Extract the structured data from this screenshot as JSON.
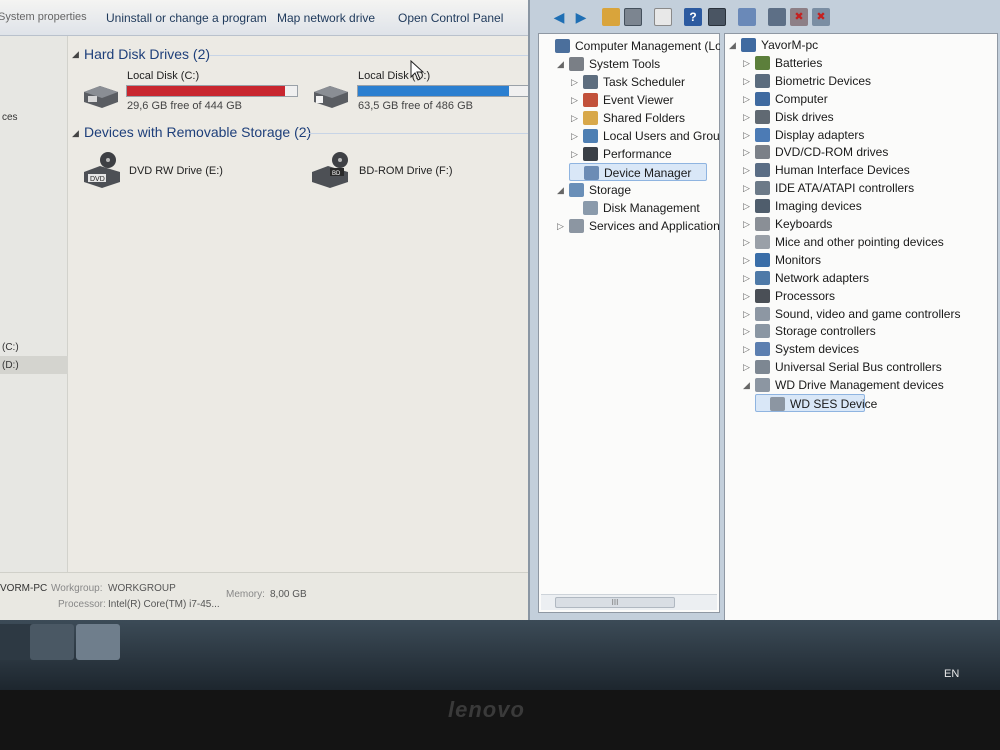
{
  "explorer": {
    "toolbar": {
      "system_properties": "System properties",
      "uninstall": "Uninstall or change a program",
      "map_drive": "Map network drive",
      "control_panel": "Open Control Panel"
    },
    "nav": {
      "item1": "ces",
      "drive_c": "(C:)",
      "drive_d": "(D:)"
    },
    "hard_disk_header": "Hard Disk Drives (2)",
    "removable_header": "Devices with Removable Storage (2)",
    "drives": [
      {
        "name": "Local Disk (C:)",
        "free": "29,6 GB free of 444 GB",
        "used_fraction": 0.93,
        "bar_color": "#c8262f"
      },
      {
        "name": "Local Disk (D:)",
        "free": "63,5 GB free of 486 GB",
        "used_fraction": 0.87,
        "bar_color": "#2b7fd0"
      }
    ],
    "removable": [
      {
        "name": "DVD RW Drive (E:)",
        "icon_text": "DVD"
      },
      {
        "name": "BD-ROM Drive (F:)",
        "icon_text": "BD"
      }
    ],
    "details": {
      "pc": "VORM-PC",
      "workgroup_label": "Workgroup:",
      "workgroup": "WORKGROUP",
      "memory_label": "Memory:",
      "memory": "8,00 GB",
      "processor_label": "Processor:",
      "processor": "Intel(R) Core(TM) i7-45..."
    }
  },
  "computer_management": {
    "tree": [
      {
        "label": "Computer Management (Local",
        "icon": "computer-management-icon",
        "expander": "",
        "indent": 0
      },
      {
        "label": "System Tools",
        "icon": "system-tools-icon",
        "expander": "◢",
        "indent": 1
      },
      {
        "label": "Task Scheduler",
        "icon": "task-scheduler-icon",
        "expander": "▷",
        "indent": 2
      },
      {
        "label": "Event Viewer",
        "icon": "event-viewer-icon",
        "expander": "▷",
        "indent": 2
      },
      {
        "label": "Shared Folders",
        "icon": "shared-folders-icon",
        "expander": "▷",
        "indent": 2
      },
      {
        "label": "Local Users and Groups",
        "icon": "local-users-icon",
        "expander": "▷",
        "indent": 2
      },
      {
        "label": "Performance",
        "icon": "performance-icon",
        "expander": "▷",
        "indent": 2
      },
      {
        "label": "Device Manager",
        "icon": "device-manager-icon",
        "expander": "",
        "indent": 2,
        "selected": true
      },
      {
        "label": "Storage",
        "icon": "storage-icon",
        "expander": "◢",
        "indent": 1
      },
      {
        "label": "Disk Management",
        "icon": "disk-management-icon",
        "expander": "",
        "indent": 2
      },
      {
        "label": "Services and Applications",
        "icon": "services-icon",
        "expander": "▷",
        "indent": 1
      }
    ],
    "tree_scroll_glyph": "III",
    "devices": [
      {
        "label": "YavorM-pc",
        "icon": "computer-icon",
        "expander": "◢",
        "indent": 0
      },
      {
        "label": "Batteries",
        "icon": "battery-icon",
        "expander": "▷",
        "indent": 1
      },
      {
        "label": "Biometric Devices",
        "icon": "biometric-icon",
        "expander": "▷",
        "indent": 1
      },
      {
        "label": "Computer",
        "icon": "computer-icon",
        "expander": "▷",
        "indent": 1
      },
      {
        "label": "Disk drives",
        "icon": "disk-drive-icon",
        "expander": "▷",
        "indent": 1
      },
      {
        "label": "Display adapters",
        "icon": "display-adapter-icon",
        "expander": "▷",
        "indent": 1
      },
      {
        "label": "DVD/CD-ROM drives",
        "icon": "dvd-icon",
        "expander": "▷",
        "indent": 1
      },
      {
        "label": "Human Interface Devices",
        "icon": "hid-icon",
        "expander": "▷",
        "indent": 1
      },
      {
        "label": "IDE ATA/ATAPI controllers",
        "icon": "ide-icon",
        "expander": "▷",
        "indent": 1
      },
      {
        "label": "Imaging devices",
        "icon": "imaging-icon",
        "expander": "▷",
        "indent": 1
      },
      {
        "label": "Keyboards",
        "icon": "keyboard-icon",
        "expander": "▷",
        "indent": 1
      },
      {
        "label": "Mice and other pointing devices",
        "icon": "mouse-icon",
        "expander": "▷",
        "indent": 1
      },
      {
        "label": "Monitors",
        "icon": "monitor-icon",
        "expander": "▷",
        "indent": 1
      },
      {
        "label": "Network adapters",
        "icon": "network-icon",
        "expander": "▷",
        "indent": 1
      },
      {
        "label": "Processors",
        "icon": "processor-icon",
        "expander": "▷",
        "indent": 1
      },
      {
        "label": "Sound, video and game controllers",
        "icon": "sound-icon",
        "expander": "▷",
        "indent": 1
      },
      {
        "label": "Storage controllers",
        "icon": "storage-controller-icon",
        "expander": "▷",
        "indent": 1
      },
      {
        "label": "System devices",
        "icon": "system-device-icon",
        "expander": "▷",
        "indent": 1
      },
      {
        "label": "Universal Serial Bus controllers",
        "icon": "usb-icon",
        "expander": "▷",
        "indent": 1
      },
      {
        "label": "WD Drive Management devices",
        "icon": "wd-icon",
        "expander": "◢",
        "indent": 1
      },
      {
        "label": "WD SES Device",
        "icon": "wd-device-icon",
        "expander": "",
        "indent": 2,
        "selected": true
      }
    ]
  },
  "taskbar": {
    "language": "EN"
  },
  "bezel": {
    "brand": "lenovo"
  }
}
